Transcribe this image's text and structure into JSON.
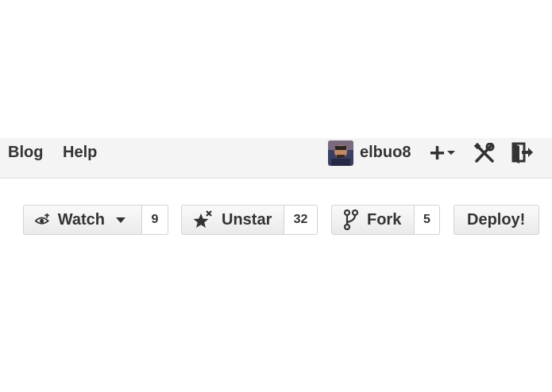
{
  "header": {
    "nav": [
      {
        "label": "Blog"
      },
      {
        "label": "Help"
      }
    ],
    "user": {
      "name": "elbuo8",
      "avatar_icon": "user-avatar"
    },
    "icons": [
      "plus-icon",
      "caret-down-icon",
      "tools-icon",
      "sign-out-icon"
    ]
  },
  "actions": {
    "watch": {
      "label": "Watch",
      "count": "9",
      "icon": "eye-plus-icon"
    },
    "star": {
      "label": "Unstar",
      "count": "32",
      "icon": "star-x-icon"
    },
    "fork": {
      "label": "Fork",
      "count": "5",
      "icon": "fork-icon"
    },
    "deploy": {
      "label": "Deploy!"
    }
  },
  "colors": {
    "header_bg": "#f4f4f4",
    "text": "#333333",
    "border": "#d3d3d3"
  }
}
